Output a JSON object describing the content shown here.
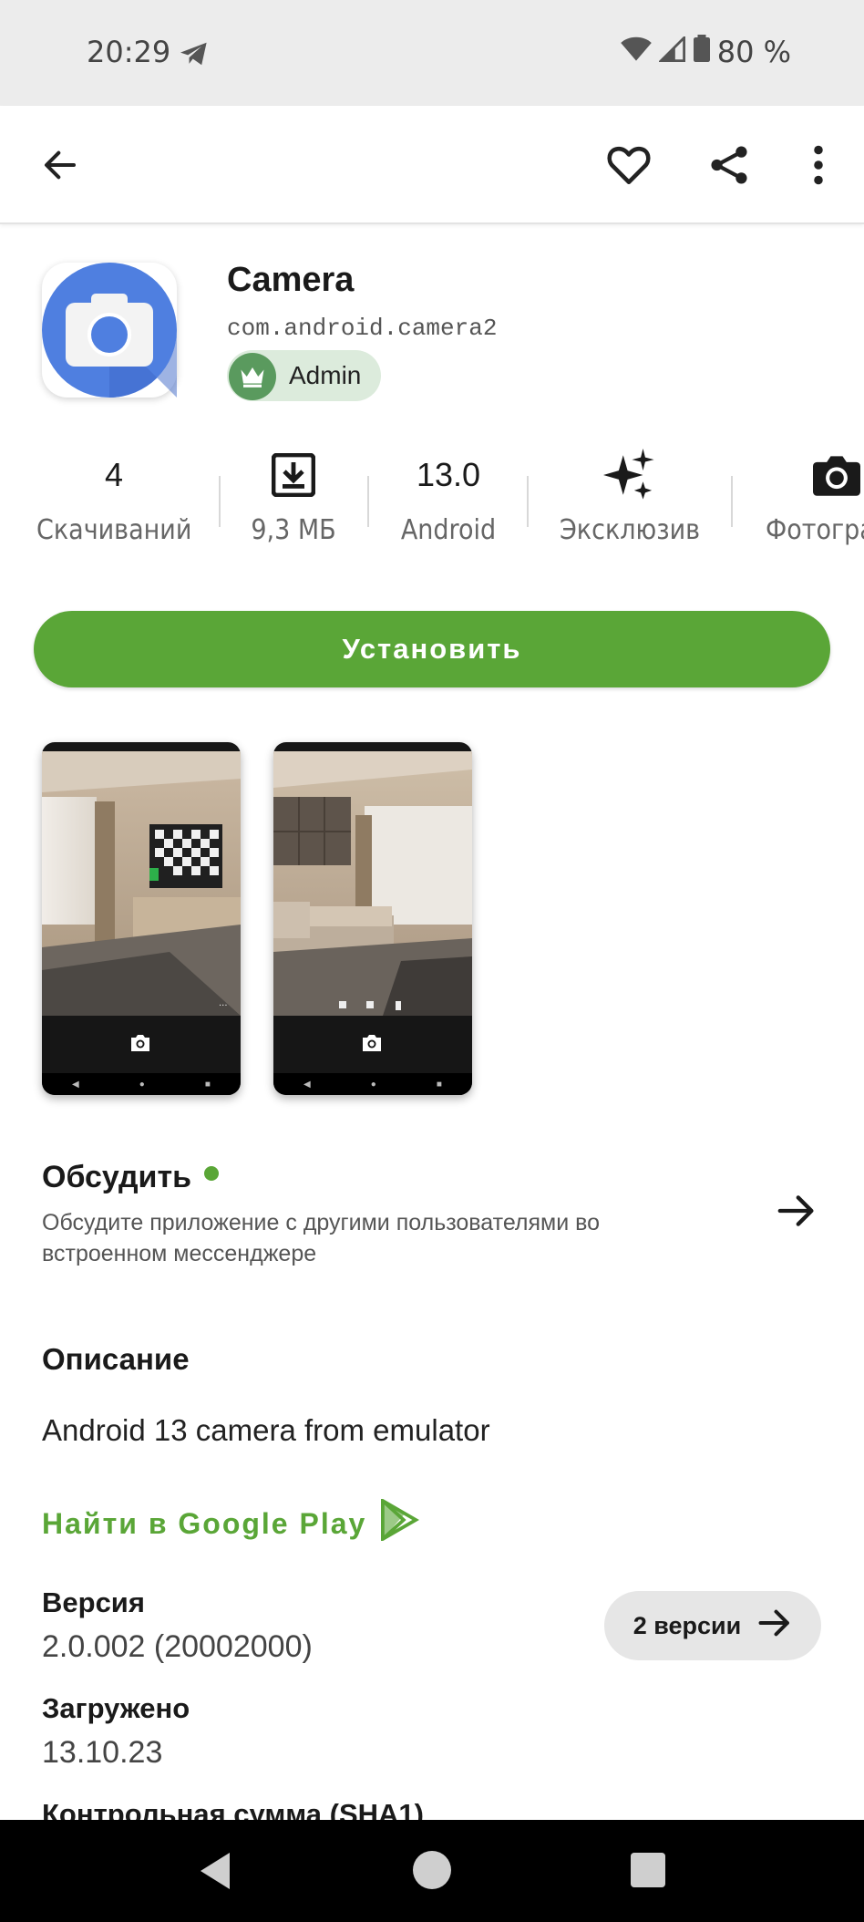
{
  "status_bar": {
    "time": "20:29",
    "battery": "80 %"
  },
  "app": {
    "title": "Camera",
    "package": "com.android.camera2",
    "badge": "Admin"
  },
  "stats": [
    {
      "value": "4",
      "label": "Скачиваний"
    },
    {
      "value": "",
      "icon": "download-icon",
      "label": "9,3 МБ"
    },
    {
      "value": "13.0",
      "label": "Android"
    },
    {
      "value": "",
      "icon": "sparkle-icon",
      "label": "Эксклюзив"
    },
    {
      "value": "",
      "icon": "camera-icon",
      "label": "Фотогра"
    }
  ],
  "install_label": "Установить",
  "discuss": {
    "title": "Обсудить",
    "subtitle": "Обсудите приложение с другими пользователями во встроенном мессенджере"
  },
  "description": {
    "title": "Описание",
    "text": "Android 13 camera from emulator",
    "google_play_link": "Найти в Google Play"
  },
  "version": {
    "title": "Версия",
    "value": "2.0.002 (20002000)",
    "versions_button": "2 версии"
  },
  "uploaded": {
    "title": "Загружено",
    "value": "13.10.23"
  },
  "checksum": {
    "title": "Контрольная сумма (SHA1)"
  },
  "colors": {
    "accent": "#5aa637",
    "icon_blue": "#4f7fe0",
    "badge_bg": "#dcebdc"
  }
}
